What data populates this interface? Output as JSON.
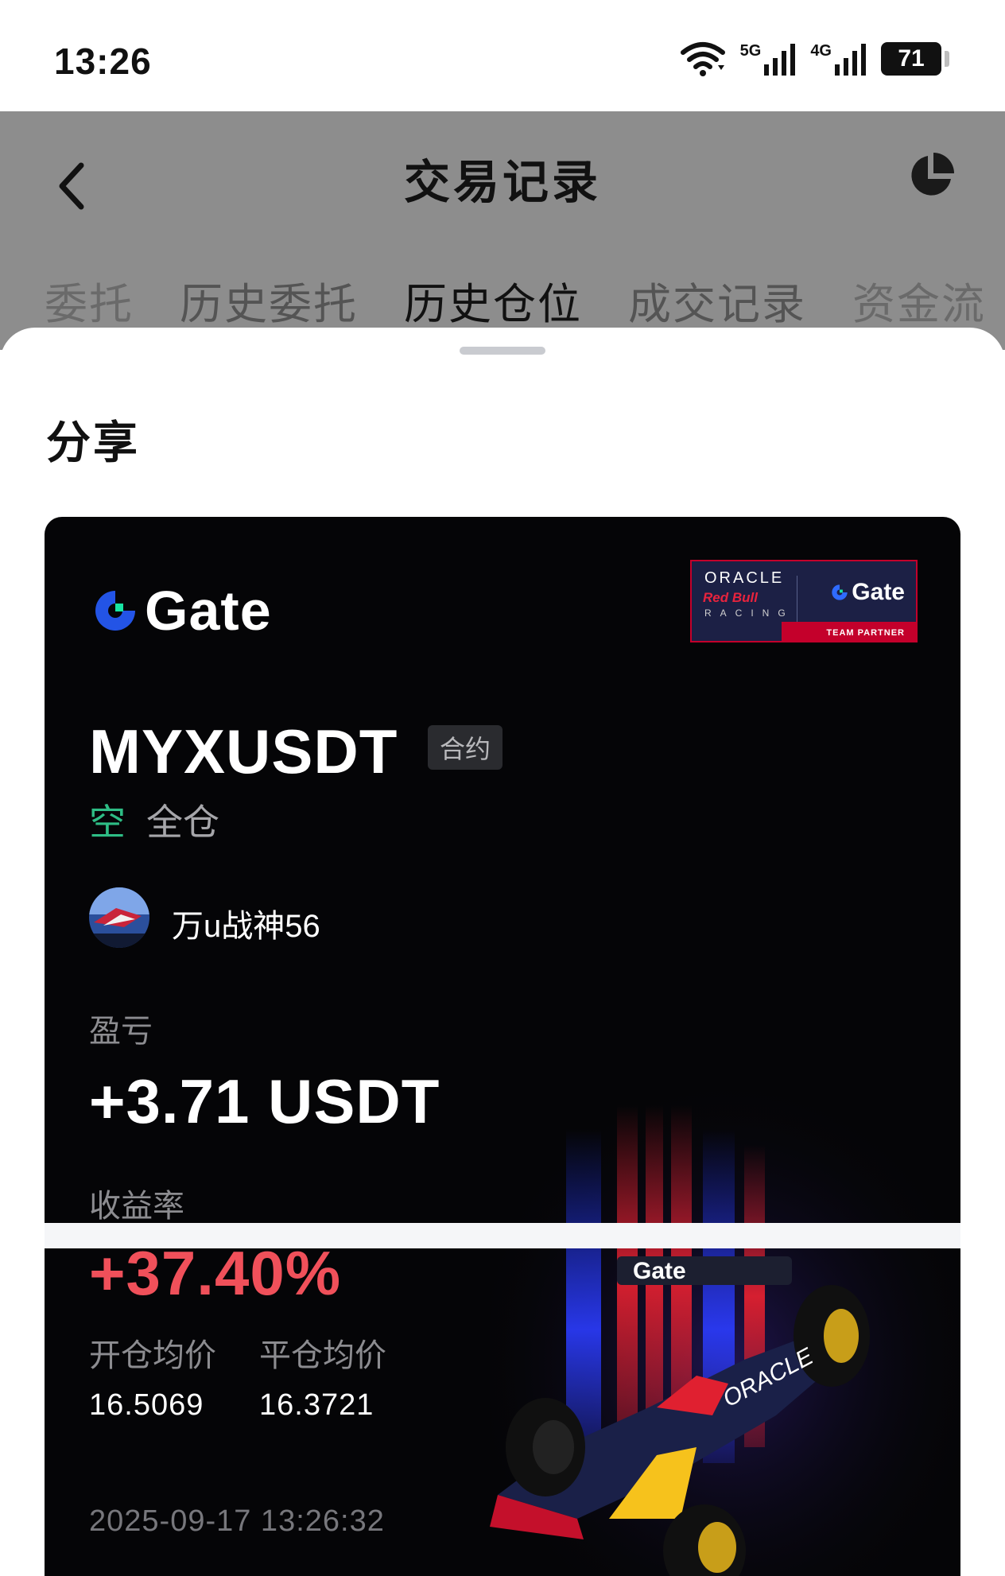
{
  "status_bar": {
    "time": "13:26",
    "network1": "5G",
    "network2": "4G",
    "battery": "71",
    "icons": [
      "wifi-icon",
      "signal-5g-icon",
      "signal-4g-icon",
      "battery-icon"
    ]
  },
  "header": {
    "title": "交易记录",
    "back_icon": "chevron-left-icon",
    "chart_icon": "pie-chart-icon"
  },
  "tabs": [
    {
      "label": "委托"
    },
    {
      "label": "历史委托"
    },
    {
      "label": "历史仓位",
      "active": true
    },
    {
      "label": "成交记录"
    },
    {
      "label": "资金流"
    }
  ],
  "share_sheet": {
    "title": "分享"
  },
  "card": {
    "brand": "Gate",
    "partner": {
      "line1": "ORACLE",
      "line2": "Red Bull",
      "line3": "RACING",
      "brand": "Gate",
      "tagline": "TEAM PARTNER"
    },
    "symbol": "MYXUSDT",
    "contract_badge": "合约",
    "side": "空",
    "margin_mode": "全仓",
    "username": "万u战神56",
    "pnl_label": "盈亏",
    "pnl_value": "+3.71 USDT",
    "roi_label": "收益率",
    "roi_value": "+37.40%",
    "open_price_label": "开仓均价",
    "open_price": "16.5069",
    "close_price_label": "平仓均价",
    "close_price": "16.3721",
    "timestamp": "2025-09-17 13:26:32"
  },
  "colors": {
    "accent_green": "#2ebd85",
    "accent_red": "#f0505a",
    "gate_blue": "#2354e6",
    "card_bg": "#050507"
  }
}
